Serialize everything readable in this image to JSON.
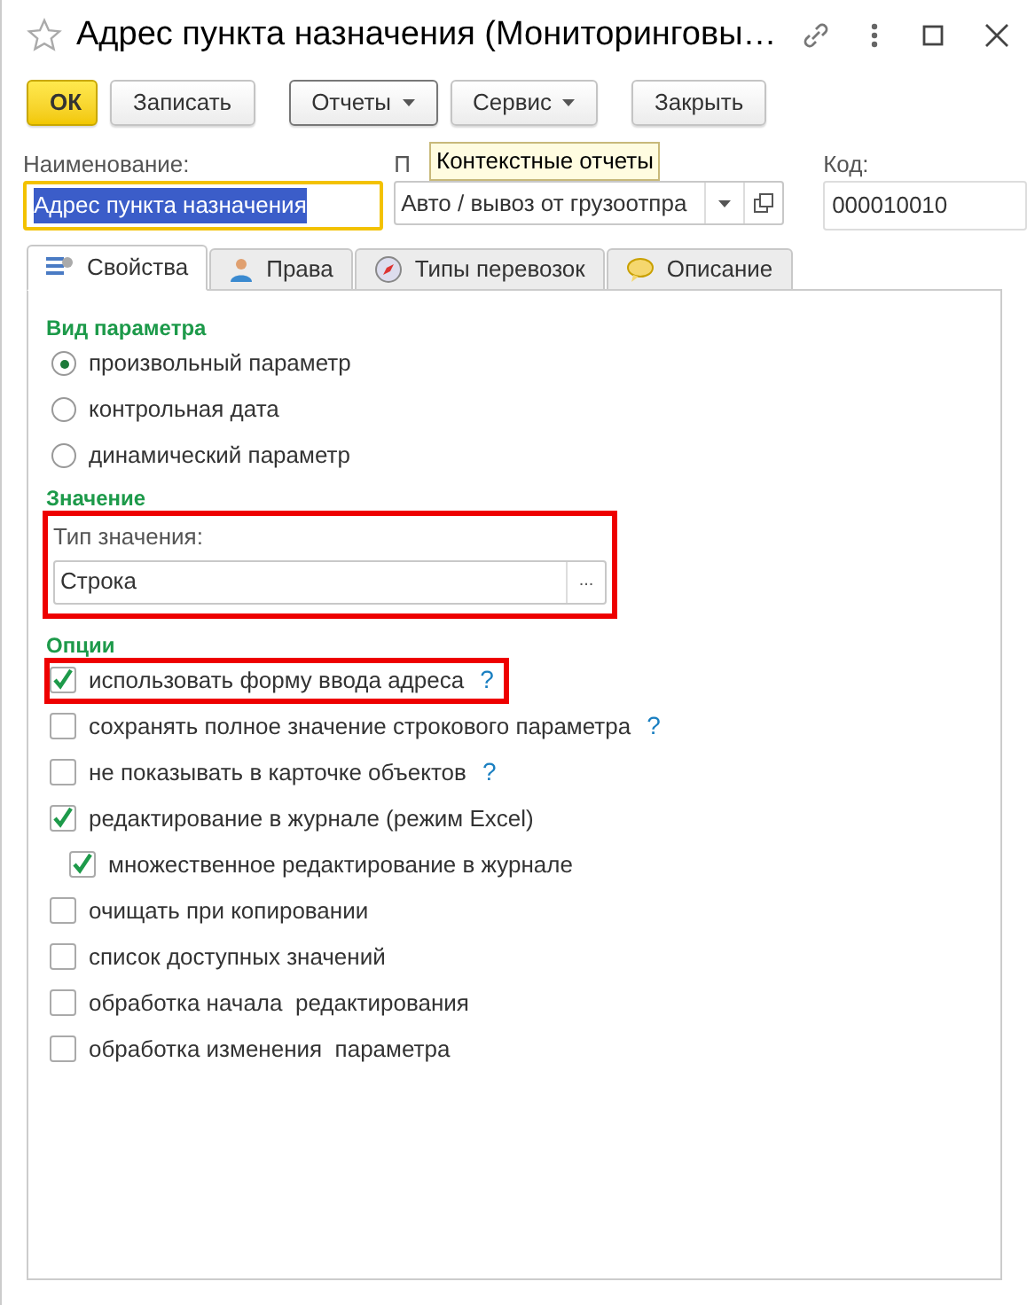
{
  "window": {
    "title": "Адрес пункта назначения (Мониторинговы…",
    "favorite": false
  },
  "toolbar": [
    {
      "label": "ОК",
      "kind": "default"
    },
    {
      "label": "Записать",
      "kind": "plain"
    },
    {
      "label": "Отчеты",
      "kind": "menu",
      "pressed": true
    },
    {
      "label": "Сервис",
      "kind": "menu",
      "pressed": false
    },
    {
      "label": "Закрыть",
      "kind": "plain"
    }
  ],
  "tooltip": "Контекстные отчеты",
  "fields": [
    {
      "label": "Наименование:",
      "value": "Адрес пункта назначения",
      "kind": "text",
      "focused": true
    },
    {
      "label": "П",
      "value": "Авто / вывоз от грузоотпра",
      "kind": "select"
    },
    {
      "label": "Код:",
      "value": "000010010",
      "kind": "text"
    }
  ],
  "tabs": [
    {
      "label": "Свойства",
      "selected": true
    },
    {
      "label": "Права",
      "selected": false
    },
    {
      "label": "Типы перевозок",
      "selected": false
    },
    {
      "label": "Описание",
      "selected": false
    }
  ],
  "param_kind": {
    "title": "Вид параметра",
    "options": [
      {
        "label": "произвольный параметр",
        "selected": true
      },
      {
        "label": "контрольная дата",
        "selected": false
      },
      {
        "label": "динамический параметр",
        "selected": false
      }
    ]
  },
  "value": {
    "title": "Значение",
    "label": "Тип значения:",
    "value": "Строка",
    "button": "...",
    "highlighted": true
  },
  "options": {
    "title": "Опции",
    "items": [
      {
        "label": "использовать форму ввода адреса",
        "checked": true,
        "help": "?",
        "highlighted": true
      },
      {
        "label": "сохранять полное значение строкового параметра",
        "checked": false,
        "help": "?",
        "highlighted": false
      },
      {
        "label": "не показывать в карточке объектов",
        "checked": false,
        "help": "?",
        "highlighted": false
      },
      {
        "label": "редактирование в журнале (режим Excel)",
        "checked": true,
        "highlighted": false,
        "children": [
          {
            "label": "множественное редактирование в журнале",
            "checked": true,
            "highlighted": false
          }
        ]
      },
      {
        "label": "очищать при копировании",
        "checked": false,
        "highlighted": false
      },
      {
        "label": "список доступных значений",
        "checked": false,
        "highlighted": false
      },
      {
        "label": "обработка начала  редактирования",
        "checked": false,
        "highlighted": false
      },
      {
        "label": "обработка изменения  параметра",
        "checked": false,
        "highlighted": false
      }
    ]
  }
}
